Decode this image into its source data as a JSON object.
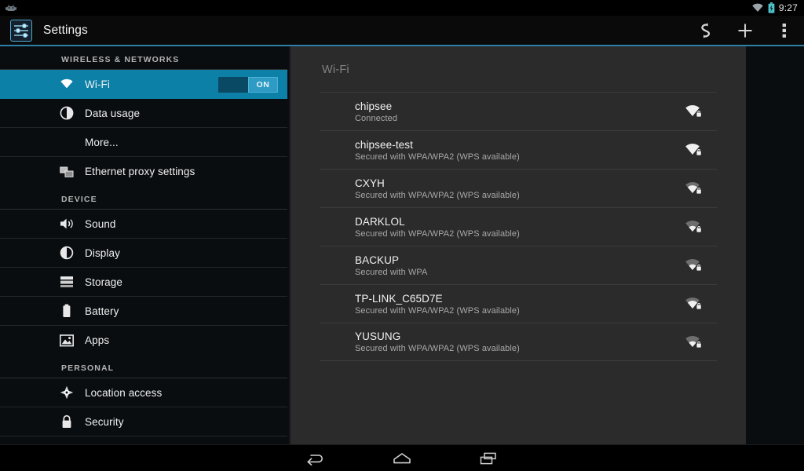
{
  "status_bar": {
    "wifi_icon": "wifi-icon",
    "battery_icon": "battery-charging-icon",
    "time": "9:27"
  },
  "action_bar": {
    "app_icon": "settings-sliders-icon",
    "title": "Settings",
    "actions": [
      {
        "name": "scan-refresh-button",
        "icon": "refresh-scan-icon"
      },
      {
        "name": "add-network-button",
        "icon": "plus-icon"
      },
      {
        "name": "overflow-menu-button",
        "icon": "more-vertical-icon"
      }
    ]
  },
  "sidebar": {
    "groups": [
      {
        "header": "WIRELESS & NETWORKS",
        "items": [
          {
            "label": "Wi-Fi",
            "icon": "wifi-icon",
            "selected": true,
            "toggle": "ON"
          },
          {
            "label": "Data usage",
            "icon": "data-usage-icon",
            "selected": false
          },
          {
            "label": "More...",
            "icon": "",
            "selected": false
          },
          {
            "label": "Ethernet proxy settings",
            "icon": "ethernet-proxy-icon",
            "selected": false
          }
        ]
      },
      {
        "header": "DEVICE",
        "items": [
          {
            "label": "Sound",
            "icon": "sound-icon",
            "selected": false
          },
          {
            "label": "Display",
            "icon": "display-icon",
            "selected": false
          },
          {
            "label": "Storage",
            "icon": "storage-icon",
            "selected": false
          },
          {
            "label": "Battery",
            "icon": "battery-icon",
            "selected": false
          },
          {
            "label": "Apps",
            "icon": "apps-icon",
            "selected": false
          }
        ]
      },
      {
        "header": "PERSONAL",
        "items": [
          {
            "label": "Location access",
            "icon": "location-icon",
            "selected": false
          },
          {
            "label": "Security",
            "icon": "lock-icon",
            "selected": false
          }
        ]
      }
    ]
  },
  "main": {
    "title": "Wi-Fi",
    "networks": [
      {
        "ssid": "chipsee",
        "status": "Connected",
        "signal": 4,
        "secured": true
      },
      {
        "ssid": "chipsee-test",
        "status": "Secured with WPA/WPA2 (WPS available)",
        "signal": 4,
        "secured": true
      },
      {
        "ssid": "CXYH",
        "status": "Secured with WPA/WPA2 (WPS available)",
        "signal": 3,
        "secured": true
      },
      {
        "ssid": "DARKLOL",
        "status": "Secured with WPA/WPA2 (WPS available)",
        "signal": 2,
        "secured": true
      },
      {
        "ssid": "BACKUP",
        "status": "Secured with WPA",
        "signal": 2,
        "secured": true
      },
      {
        "ssid": "TP-LINK_C65D7E",
        "status": "Secured with WPA/WPA2 (WPS available)",
        "signal": 3,
        "secured": true
      },
      {
        "ssid": "YUSUNG",
        "status": "Secured with WPA/WPA2 (WPS available)",
        "signal": 2,
        "secured": true
      }
    ]
  },
  "nav_bar": {
    "buttons": [
      {
        "name": "back-button",
        "icon": "back-arrow-icon"
      },
      {
        "name": "home-button",
        "icon": "home-icon"
      },
      {
        "name": "recents-button",
        "icon": "recents-icon"
      }
    ]
  },
  "colors": {
    "accent": "#0d80a8",
    "accent_line": "#2e7fa6",
    "sidebar_bg": "#0a0d10",
    "panel_bg": "#2b2b2b",
    "battery": "#4ec0c8"
  }
}
